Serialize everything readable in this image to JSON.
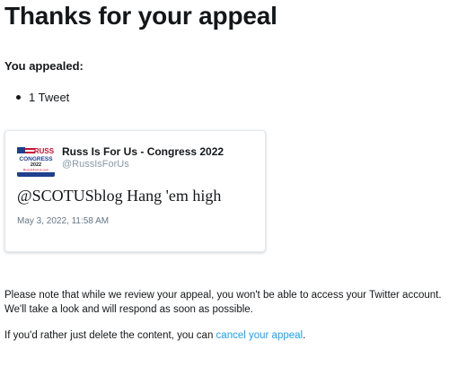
{
  "page": {
    "title": "Thanks for your appeal",
    "appealed_label": "You appealed:",
    "items": [
      "1 Tweet"
    ]
  },
  "tweet": {
    "author_name": "Russ Is For Us - Congress 2022",
    "author_handle": "@RussIsForUs",
    "text": "@SCOTUSblog Hang 'em high",
    "timestamp": "May 3, 2022, 11:58 AM",
    "avatar": {
      "icon": "campaign-logo-flag-icon",
      "line1": "RUSS",
      "line2": "CONGRESS",
      "line3": "2022",
      "line4": "RussIsForUs.com"
    }
  },
  "notice": {
    "text": "Please note that while we review your appeal, you won't be able to access your Twitter account. We'll take a look and will respond as soon as possible.",
    "cancel_prefix": "If you'd rather just delete the content, you can ",
    "cancel_link": "cancel your appeal",
    "cancel_suffix": "."
  },
  "colors": {
    "text": "#14171a",
    "secondary": "#657786",
    "handle": "#8899a6",
    "link": "#1da1f2",
    "card_border": "#e1e8ed",
    "logo_red": "#c8102e",
    "logo_blue": "#1f3f8f"
  }
}
